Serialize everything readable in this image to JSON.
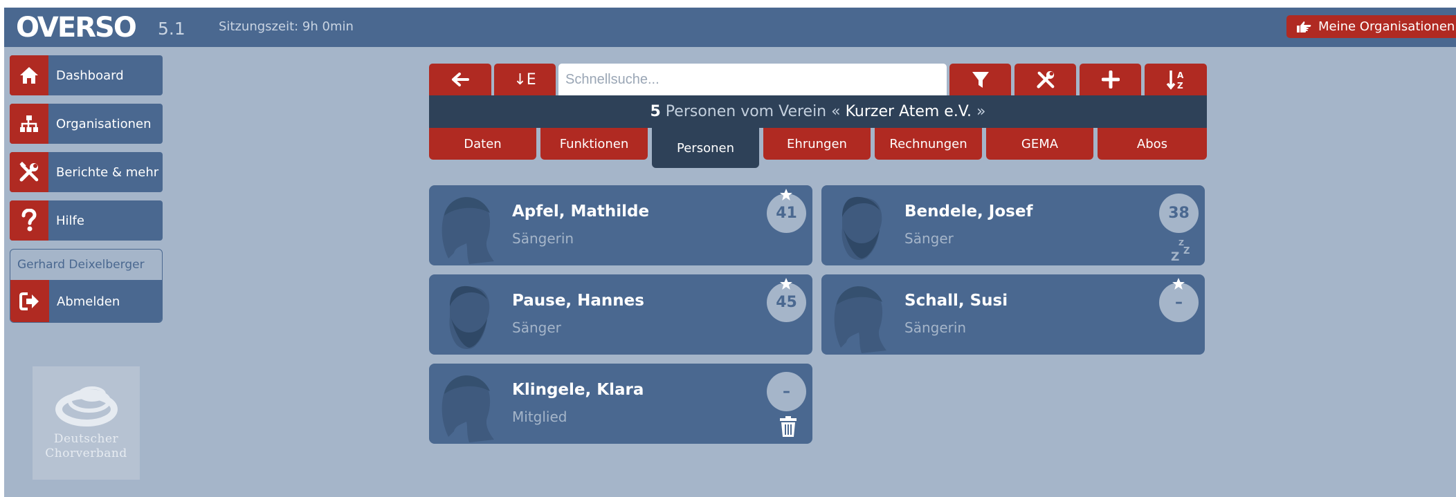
{
  "app": {
    "logo": "OVERSO",
    "version": "5.1",
    "session": "Sitzungszeit: 9h 0min",
    "my_orgs": "Meine Organisationen"
  },
  "sidebar": {
    "items": [
      {
        "label": "Dashboard",
        "icon": "home-icon"
      },
      {
        "label": "Organisationen",
        "icon": "sitemap-icon"
      },
      {
        "label": "Berichte & mehr",
        "icon": "tools-icon"
      },
      {
        "label": "Hilfe",
        "icon": "question-icon"
      }
    ],
    "user": "Gerhard Deixelberger",
    "logout": "Abmelden"
  },
  "logo_dcv": {
    "line1": "Deutscher",
    "line2": "Chorverband"
  },
  "toolbar": {
    "sort_label": "↓E",
    "search_placeholder": "Schnellsuche...",
    "icons": [
      "arrow-left-icon",
      "filter-icon",
      "tools-icon",
      "plus-icon",
      "sort-alpha-icon"
    ]
  },
  "info": {
    "count": "5",
    "text": "Personen vom Verein «",
    "org": "Kurzer Atem e.V.",
    "suffix": "»"
  },
  "tabs": [
    "Daten",
    "Funktionen",
    "Personen",
    "Ehrungen",
    "Rechnungen",
    "GEMA",
    "Abos"
  ],
  "active_tab": "Personen",
  "persons": [
    {
      "name": "Apfel, Mathilde",
      "role": "Sängerin",
      "badge": "41",
      "star": true,
      "gender": "female"
    },
    {
      "name": "Bendele, Josef",
      "role": "Sänger",
      "badge": "38",
      "star": false,
      "sub_icon": "sleep-icon",
      "gender": "male"
    },
    {
      "name": "Pause, Hannes",
      "role": "Sänger",
      "badge": "45",
      "star": true,
      "gender": "male"
    },
    {
      "name": "Schall, Susi",
      "role": "Sängerin",
      "badge": "–",
      "star": true,
      "gender": "female"
    },
    {
      "name": "Klingele, Klara",
      "role": "Mitglied",
      "badge": "–",
      "star": false,
      "sub_icon": "trash-icon",
      "gender": "female"
    }
  ],
  "colors": {
    "primary": "#4a6890",
    "accent": "#b02a22",
    "background": "#a5b5c9",
    "dark": "#2e4158"
  }
}
